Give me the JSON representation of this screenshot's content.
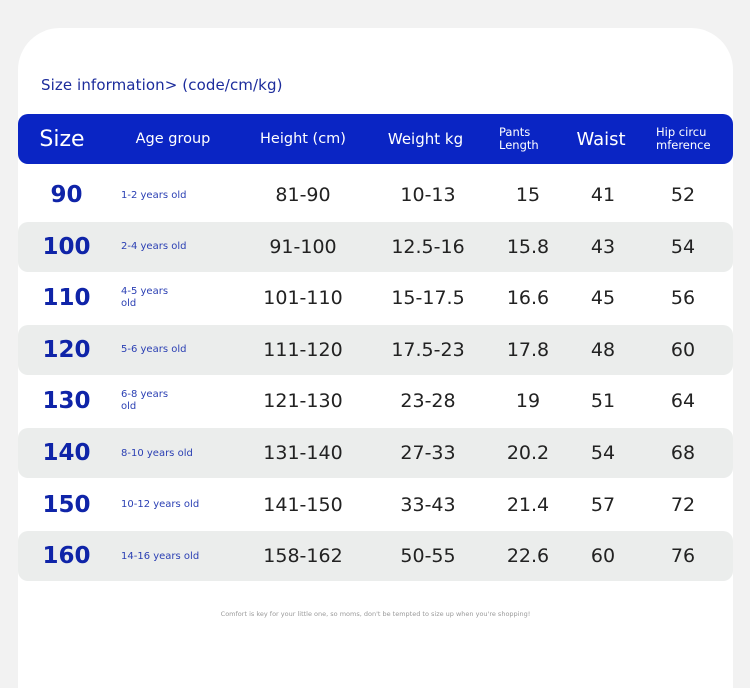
{
  "title": "Size information> (code/cm/kg)",
  "header": {
    "size": "Size",
    "age": "Age group",
    "height": "Height (cm)",
    "weight": "Weight kg",
    "pants": "Pants Length",
    "waist": "Waist",
    "hip": "Hip circumference"
  },
  "rows": [
    {
      "size": "90",
      "age": "1-2 years old",
      "height": "81-90",
      "weight": "10-13",
      "pants": "15",
      "waist": "41",
      "hip": "52"
    },
    {
      "size": "100",
      "age": "2-4 years old",
      "height": "91-100",
      "weight": "12.5-16",
      "pants": "15.8",
      "waist": "43",
      "hip": "54"
    },
    {
      "size": "110",
      "age": "4-5 years old",
      "height": "101-110",
      "weight": "15-17.5",
      "pants": "16.6",
      "waist": "45",
      "hip": "56"
    },
    {
      "size": "120",
      "age": "5-6 years old",
      "height": "111-120",
      "weight": "17.5-23",
      "pants": "17.8",
      "waist": "48",
      "hip": "60"
    },
    {
      "size": "130",
      "age": "6-8 years old",
      "height": "121-130",
      "weight": "23-28",
      "pants": "19",
      "waist": "51",
      "hip": "64"
    },
    {
      "size": "140",
      "age": "8-10 years old",
      "height": "131-140",
      "weight": "27-33",
      "pants": "20.2",
      "waist": "54",
      "hip": "68"
    },
    {
      "size": "150",
      "age": "10-12 years old",
      "height": "141-150",
      "weight": "33-43",
      "pants": "21.4",
      "waist": "57",
      "hip": "72"
    },
    {
      "size": "160",
      "age": "14-16 years old",
      "height": "158-162",
      "weight": "50-55",
      "pants": "22.6",
      "waist": "60",
      "hip": "76"
    }
  ],
  "footnote": "Comfort is key for your little one, so moms, don't be tempted to size up when you're shopping!",
  "colors": {
    "header_bg": "#0a25c4",
    "accent_text": "#0f24a8",
    "alt_row_bg": "#ebedec",
    "page_bg": "#f2f2f2"
  }
}
